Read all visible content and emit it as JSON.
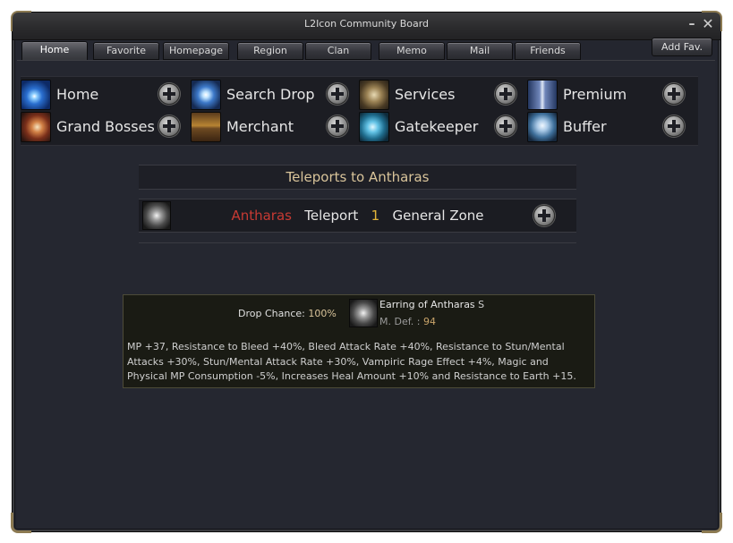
{
  "window": {
    "title": "L2Icon Community Board",
    "minimize_glyph": "–",
    "close_glyph": "✕"
  },
  "tabs": [
    "Home",
    "Favorite",
    "Homepage",
    "Region",
    "Clan",
    "Memo",
    "Mail",
    "Friends"
  ],
  "active_tab": "Home",
  "add_fav_label": "Add Fav.",
  "nav": [
    {
      "label": "Home",
      "icon": "home-icon"
    },
    {
      "label": "Search Drop",
      "icon": "search-drop-icon"
    },
    {
      "label": "Services",
      "icon": "services-icon"
    },
    {
      "label": "Premium",
      "icon": "premium-icon"
    },
    {
      "label": "Grand Bosses",
      "icon": "grand-bosses-icon"
    },
    {
      "label": "Merchant",
      "icon": "merchant-icon"
    },
    {
      "label": "Gatekeeper",
      "icon": "gatekeeper-icon"
    },
    {
      "label": "Buffer",
      "icon": "buffer-icon"
    }
  ],
  "teleports": {
    "title": "Teleports to Antharas",
    "row": {
      "boss": "Antharas",
      "teleport": "Teleport",
      "count": "1",
      "zone": "General Zone"
    }
  },
  "tooltip": {
    "drop_label": "Drop Chance: ",
    "drop_value": "100%",
    "item_name": "Earring of Antharas",
    "item_grade": "S",
    "stat_label": "M. Def. : ",
    "stat_value": "94",
    "description": "MP +37, Resistance to Bleed +40%, Bleed Attack Rate +40%, Resistance to Stun/Mental\nAttacks +30%, Stun/Mental Attack Rate +30%, Vampiric Rage Effect +4%, Magic and\nPhysical MP Consumption -5%, Increases Heal Amount +10% and Resistance to Earth +15."
  },
  "colors": {
    "background": "#24262f",
    "accent_gold": "#d9c49a",
    "boss_red": "#c73a33",
    "number_yellow": "#e2b43a"
  }
}
